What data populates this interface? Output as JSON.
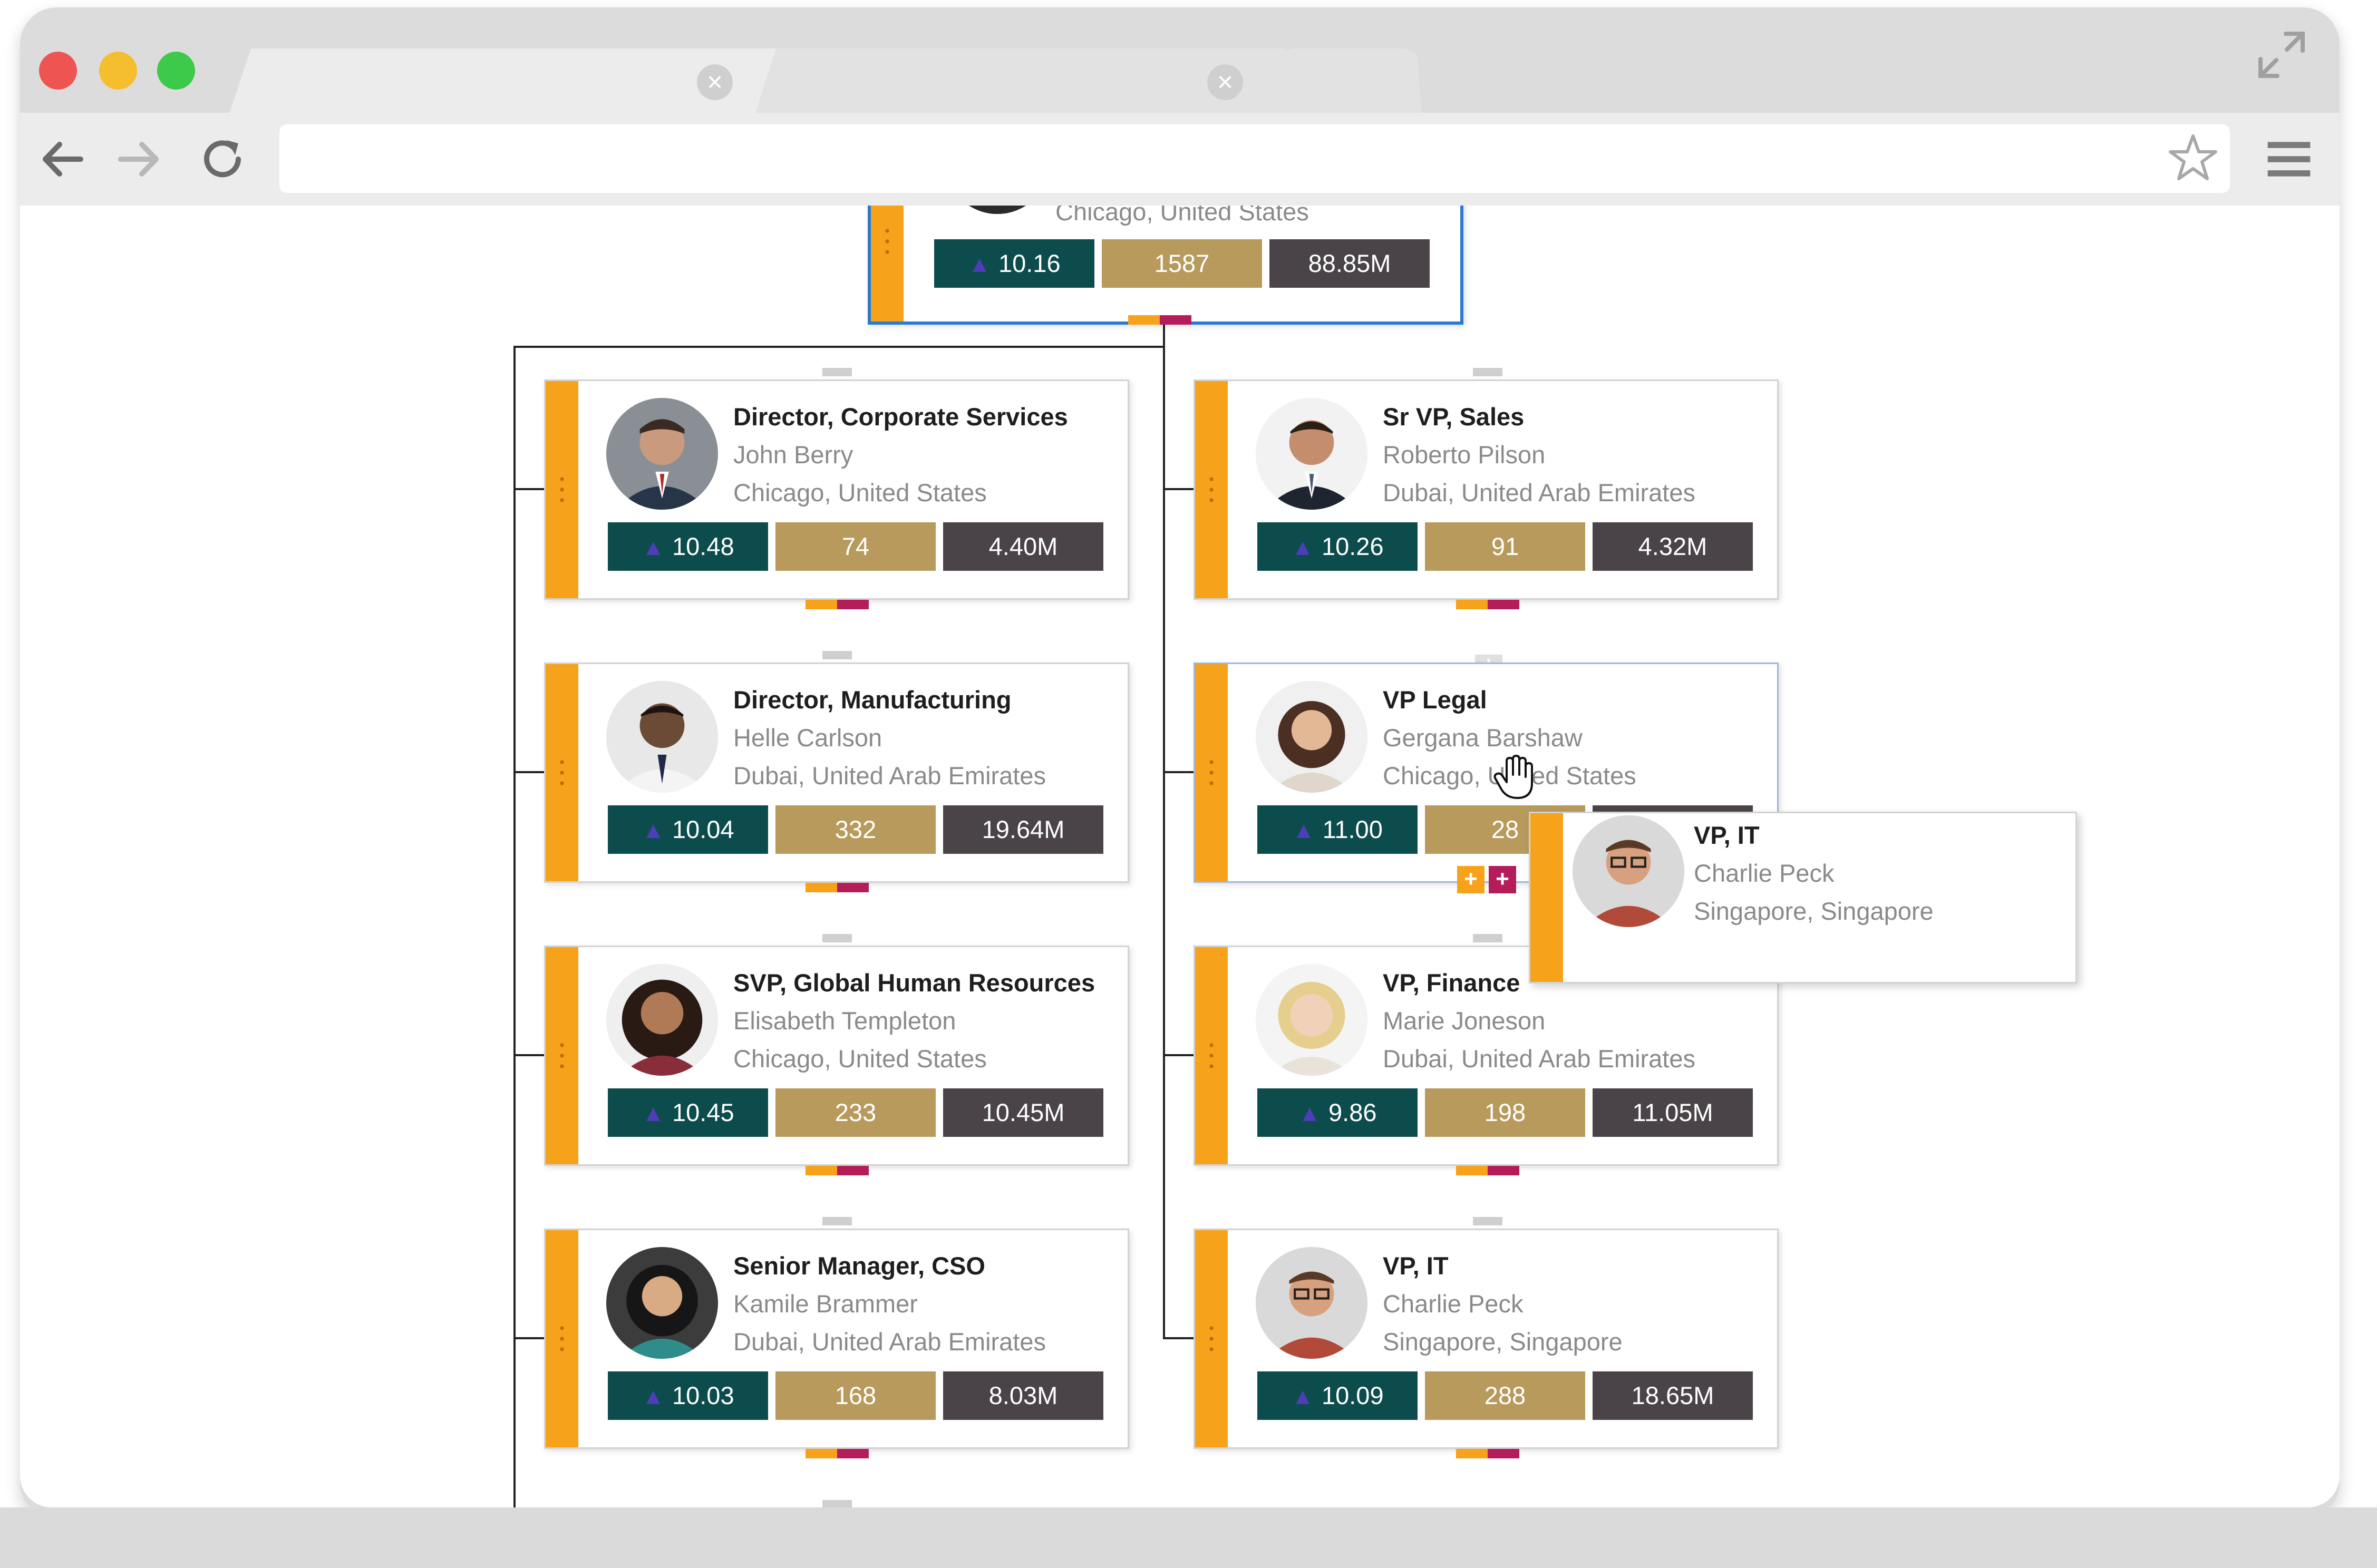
{
  "window": {
    "tabs": [
      {
        "label": "",
        "close_icon": "close-icon"
      },
      {
        "label": "",
        "close_icon": "close-icon"
      }
    ],
    "address": ""
  },
  "colors": {
    "stripe": "#f6a21b",
    "score": "#0d4c4c",
    "count": "#b79a5c",
    "amount": "#4a4448",
    "accent_magenta": "#b41d59"
  },
  "top_card": {
    "location": "Chicago, United States",
    "score": "10.16",
    "count": "1587",
    "amount": "88.85M"
  },
  "left_column": [
    {
      "title": "Director, Corporate Services",
      "name": "John Berry",
      "location": "Chicago, United States",
      "score": "10.48",
      "count": "74",
      "amount": "4.40M"
    },
    {
      "title": "Director, Manufacturing",
      "name": "Helle Carlson",
      "location": "Dubai, United Arab Emirates",
      "score": "10.04",
      "count": "332",
      "amount": "19.64M"
    },
    {
      "title": "SVP, Global Human Resources",
      "name": "Elisabeth Templeton",
      "location": "Chicago, United States",
      "score": "10.45",
      "count": "233",
      "amount": "10.45M"
    },
    {
      "title": "Senior Manager, CSO",
      "name": "Kamile Brammer",
      "location": "Dubai, United Arab Emirates",
      "score": "10.03",
      "count": "168",
      "amount": "8.03M"
    }
  ],
  "right_column": [
    {
      "title": "Sr VP, Sales",
      "name": "Roberto Pilson",
      "location": "Dubai, United Arab Emirates",
      "score": "10.26",
      "count": "91",
      "amount": "4.32M"
    },
    {
      "title": "VP Legal",
      "name": "Gergana Barshaw",
      "location": "Chicago, United States",
      "score": "11.00",
      "count": "28",
      "amount": ""
    },
    {
      "title": "VP, Finance",
      "name": "Marie Joneson",
      "location": "Dubai, United Arab Emirates",
      "score": "9.86",
      "count": "198",
      "amount": "11.05M"
    },
    {
      "title": "VP, IT",
      "name": "Charlie Peck",
      "location": "Singapore, Singapore",
      "score": "10.09",
      "count": "288",
      "amount": "18.65M"
    }
  ],
  "dragging_card": {
    "title": "VP, IT",
    "name": "Charlie Peck",
    "location": "Singapore, Singapore"
  },
  "expand_buttons": [
    "+",
    "+"
  ]
}
